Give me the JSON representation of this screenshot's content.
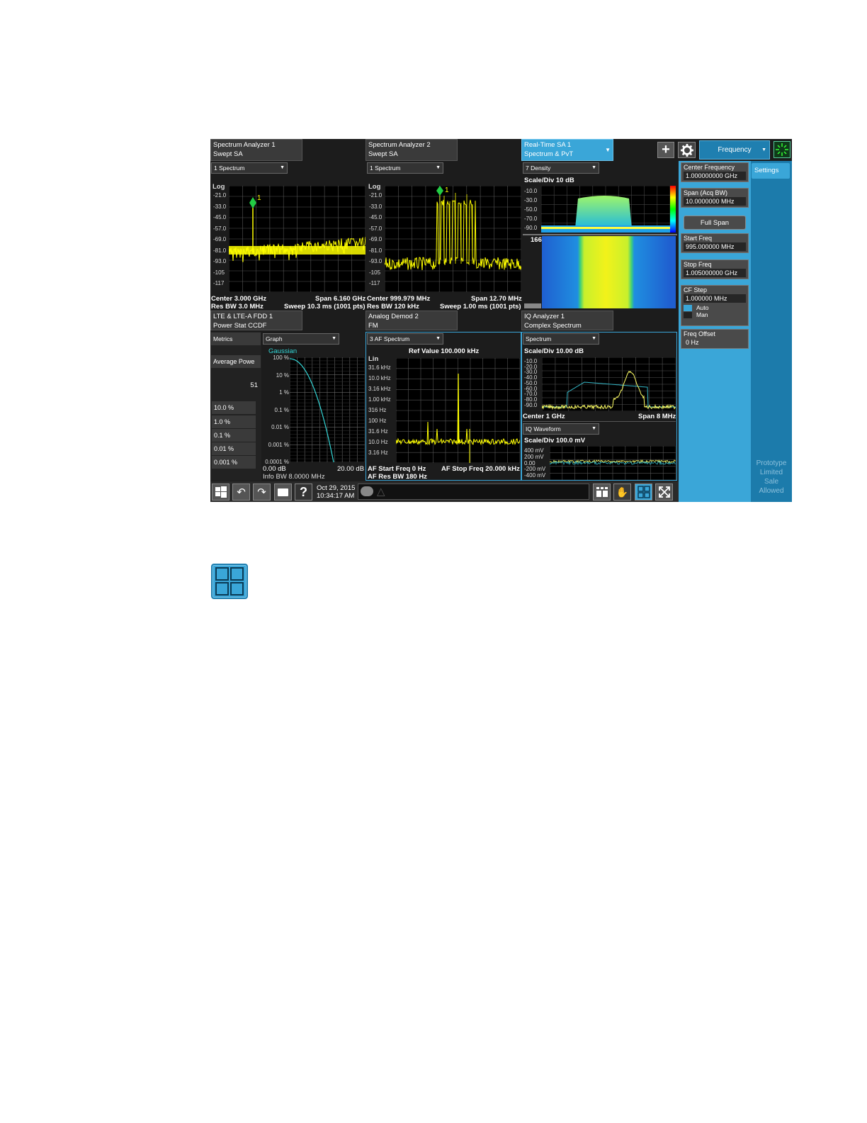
{
  "top_bar": {
    "tab1": {
      "line1": "Spectrum Analyzer 1",
      "line2": "Swept SA"
    },
    "tab2": {
      "line1": "Spectrum Analyzer 2",
      "line2": "Swept SA"
    },
    "tab3": {
      "line1": "Real-Time SA 1",
      "line2": "Spectrum & PvT"
    },
    "add_symbol": "+",
    "menu_label": "Frequency"
  },
  "sa1": {
    "window": "1 Spectrum",
    "scale": "Log",
    "y_ticks": [
      "-21.0",
      "-33.0",
      "-45.0",
      "-57.0",
      "-69.0",
      "-81.0",
      "-93.0",
      "-105",
      "-117"
    ],
    "marker": "1",
    "center": "Center 3.000 GHz",
    "span": "Span 6.160 GHz",
    "rbw": "Res BW 3.0 MHz",
    "sweep": "Sweep 10.3 ms (1001 pts)"
  },
  "sa2": {
    "window": "1 Spectrum",
    "scale": "Log",
    "y_ticks": [
      "-21.0",
      "-33.0",
      "-45.0",
      "-57.0",
      "-69.0",
      "-81.0",
      "-93.0",
      "-105",
      "-117"
    ],
    "marker": "1",
    "center": "Center 999.979 MHz",
    "span": "Span 12.70 MHz",
    "rbw": "Res BW 120 kHz",
    "sweep": "Sweep 1.00 ms (1001 pts)"
  },
  "rt": {
    "window": "7 Density",
    "scale": "Scale/Div 10 dB",
    "y_ticks": [
      "-10.0",
      "-30.0",
      "-50.0",
      "-70.0",
      "-90.0"
    ],
    "count": "166"
  },
  "settings": {
    "tab": "Settings",
    "center_freq": {
      "label": "Center Frequency",
      "value": "1.000000000 GHz"
    },
    "span": {
      "label": "Span (Acq BW)",
      "value": "10.0000000 MHz"
    },
    "full_span": "Full Span",
    "start_freq": {
      "label": "Start Freq",
      "value": "995.000000 MHz"
    },
    "stop_freq": {
      "label": "Stop Freq",
      "value": "1.005000000 GHz"
    },
    "cf_step": {
      "label": "CF Step",
      "value": "1.000000 MHz",
      "auto": "Auto",
      "man": "Man"
    },
    "freq_offset": {
      "label": "Freq Offset",
      "value": "0 Hz"
    },
    "watermark": [
      "Prototype",
      "Limited",
      "Sale",
      "Allowed"
    ]
  },
  "lte": {
    "tab": {
      "line1": "LTE & LTE-A FDD 1",
      "line2": "Power Stat CCDF"
    },
    "metrics_label": "Metrics",
    "graph_label": "Graph",
    "gaussian": "Gaussian",
    "avg_power": "Average Powe",
    "avg_value": "51",
    "rows": [
      "10.0 %",
      "1.0 %",
      "0.1 %",
      "0.01 %",
      "0.001 %"
    ],
    "y_ticks": [
      "100 %",
      "10 %",
      "1 %",
      "0.1 %",
      "0.01 %",
      "0.001 %",
      "0.0001 %"
    ],
    "x_left": "0.00 dB",
    "x_right": "20.00 dB",
    "info_bw": "Info BW 8.0000 MHz"
  },
  "demod": {
    "tab": {
      "line1": "Analog Demod 2",
      "line2": "FM"
    },
    "window": "3 AF Spectrum",
    "ref": "Ref Value 100.000 kHz",
    "scale": "Lin",
    "y_ticks": [
      "31.6 kHz",
      "10.0 kHz",
      "3.16 kHz",
      "1.00 kHz",
      "316 Hz",
      "100 Hz",
      "31.6 Hz",
      "10.0 Hz",
      "3.16 Hz"
    ],
    "start": "AF Start Freq 0 Hz",
    "stop": "AF Stop Freq 20.000 kHz",
    "rbw": "AF Res BW 180 Hz"
  },
  "iq": {
    "tab": {
      "line1": "IQ Analyzer 1",
      "line2": "Complex Spectrum"
    },
    "window1": "Spectrum",
    "scale1": "Scale/Div 10.00 dB",
    "y_ticks1": [
      "-10.0",
      "-20.0",
      "-30.0",
      "-40.0",
      "-50.0",
      "-60.0",
      "-70.0",
      "-80.0",
      "-90.0"
    ],
    "center": "Center 1 GHz",
    "span": "Span 8 MHz",
    "window2": "IQ Waveform",
    "scale2": "Scale/Div 100.0 mV",
    "y_ticks2": [
      "400 mV",
      "200 mV",
      "0.00",
      "-200 mV",
      "-400 mV"
    ]
  },
  "taskbar": {
    "date": "Oct 29, 2015",
    "time": "10:34:17 AM",
    "help": "?"
  }
}
